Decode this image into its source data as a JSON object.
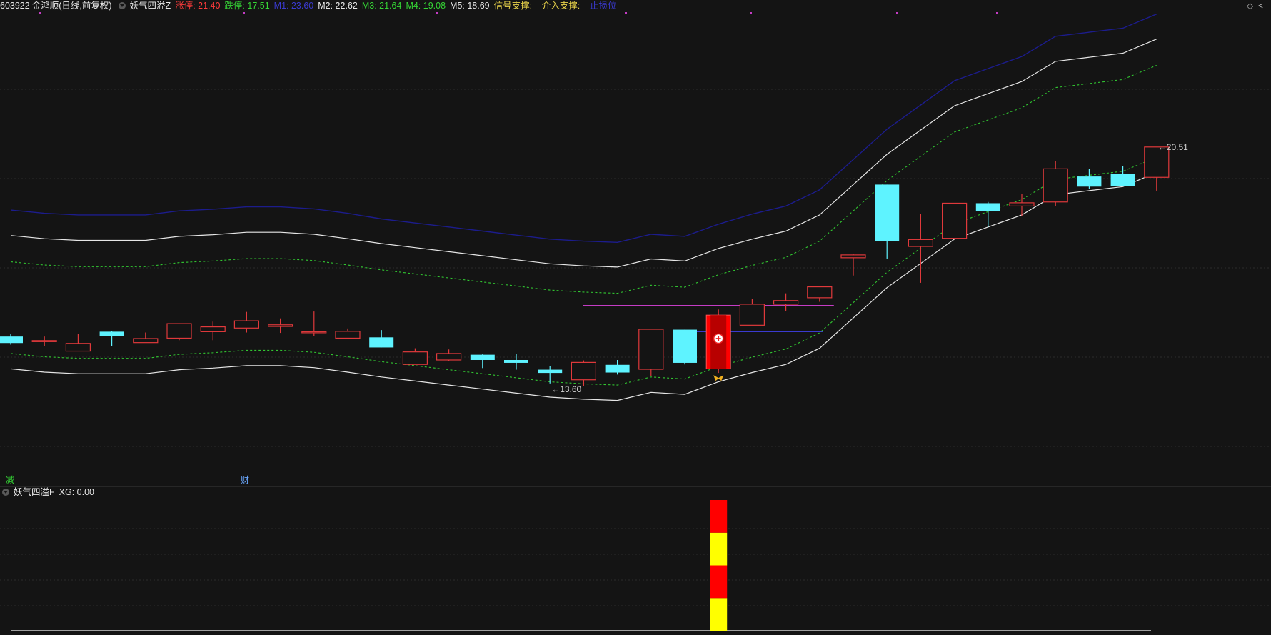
{
  "header": {
    "code": "603922",
    "name": "金鸿顺",
    "period": "(日线,前复权)",
    "indicator": "妖气四溢Z",
    "items": [
      {
        "label": "涨停: 21.40",
        "color": "#ff3b3b"
      },
      {
        "label": "跌停: 17.51",
        "color": "#35d435"
      },
      {
        "label": "M1: 23.60",
        "color": "#3a3ad0"
      },
      {
        "label": "M2: 22.62",
        "color": "#e8e8e8"
      },
      {
        "label": "M3: 21.64",
        "color": "#35d435"
      },
      {
        "label": "M4: 19.08",
        "color": "#35d435"
      },
      {
        "label": "M5: 18.69",
        "color": "#e8e8e8"
      },
      {
        "label": "信号支撑: -",
        "color": "#e8d24a"
      },
      {
        "label": "介入支撑: -",
        "color": "#e8d24a"
      },
      {
        "label": "止损位",
        "color": "#3a3ad0"
      }
    ],
    "corner_icons": [
      "diamond-icon",
      "chevron-left-icon"
    ]
  },
  "lower_header": {
    "indicator": "妖气四溢F",
    "value": "XG: 0.00"
  },
  "markers": {
    "low_label": "←13.60",
    "high_label": "←20.51",
    "event_reduce": "减",
    "event_finance": "财"
  },
  "colors": {
    "background": "#141414",
    "up": "#e0393b",
    "down": "#5ef3ff",
    "m1": "#1c1c8c",
    "band": "#e6e6e6",
    "dashed": "#31c631",
    "grid": "#2b2b2b",
    "signal_red": "#ff0000",
    "signal_yellow": "#ffff00",
    "magenta": "#c43cc4"
  },
  "chart_data": [
    {
      "type": "candlestick",
      "title": "",
      "ylim": [
        12.5,
        24.2
      ],
      "candles": [
        {
          "o": 16.12,
          "c": 15.96,
          "h": 16.18,
          "l": 15.92
        },
        {
          "o": 16.0,
          "c": 16.02,
          "h": 16.12,
          "l": 15.88
        },
        {
          "o": 15.76,
          "c": 15.95,
          "h": 16.19,
          "l": 15.76
        },
        {
          "o": 16.24,
          "c": 16.14,
          "h": 16.25,
          "l": 15.88
        },
        {
          "o": 15.97,
          "c": 16.07,
          "h": 16.22,
          "l": 15.97
        },
        {
          "o": 16.08,
          "c": 16.44,
          "h": 16.45,
          "l": 16.03
        },
        {
          "o": 16.24,
          "c": 16.36,
          "h": 16.49,
          "l": 16.03
        },
        {
          "o": 16.33,
          "c": 16.51,
          "h": 16.73,
          "l": 16.22
        },
        {
          "o": 16.37,
          "c": 16.41,
          "h": 16.57,
          "l": 16.21
        },
        {
          "o": 16.23,
          "c": 16.24,
          "h": 16.74,
          "l": 16.14
        },
        {
          "o": 16.08,
          "c": 16.25,
          "h": 16.32,
          "l": 16.08
        },
        {
          "o": 16.1,
          "c": 15.85,
          "h": 16.28,
          "l": 15.85
        },
        {
          "o": 15.43,
          "c": 15.74,
          "h": 15.83,
          "l": 15.43
        },
        {
          "o": 15.54,
          "c": 15.7,
          "h": 15.8,
          "l": 15.51
        },
        {
          "o": 15.67,
          "c": 15.54,
          "h": 15.68,
          "l": 15.34
        },
        {
          "o": 15.54,
          "c": 15.47,
          "h": 15.69,
          "l": 15.3
        },
        {
          "o": 15.3,
          "c": 15.22,
          "h": 15.39,
          "l": 14.96
        },
        {
          "o": 15.05,
          "c": 15.48,
          "h": 15.53,
          "l": 14.89
        },
        {
          "o": 15.42,
          "c": 15.23,
          "h": 15.54,
          "l": 15.18
        },
        {
          "o": 15.31,
          "c": 16.3,
          "h": 16.3,
          "l": 15.15
        },
        {
          "o": 16.29,
          "c": 15.47,
          "h": 16.29,
          "l": 15.43
        },
        {
          "o": 15.32,
          "c": 16.65,
          "h": 16.79,
          "l": 15.22
        },
        {
          "o": 16.4,
          "c": 16.92,
          "h": 17.06,
          "l": 16.4
        },
        {
          "o": 16.92,
          "c": 17.01,
          "h": 17.19,
          "l": 16.76
        },
        {
          "o": 17.08,
          "c": 17.35,
          "h": 17.35,
          "l": 16.98
        },
        {
          "o": 18.07,
          "c": 18.14,
          "h": 18.16,
          "l": 17.63
        },
        {
          "o": 19.88,
          "c": 18.48,
          "h": 19.88,
          "l": 18.05
        },
        {
          "o": 18.35,
          "c": 18.52,
          "h": 19.15,
          "l": 17.45
        },
        {
          "o": 18.55,
          "c": 19.42,
          "h": 19.42,
          "l": 18.55
        },
        {
          "o": 19.42,
          "c": 19.23,
          "h": 19.45,
          "l": 18.83
        },
        {
          "o": 19.35,
          "c": 19.43,
          "h": 19.65,
          "l": 19.1
        },
        {
          "o": 19.45,
          "c": 20.27,
          "h": 20.46,
          "l": 19.34
        },
        {
          "o": 20.08,
          "c": 19.83,
          "h": 20.27,
          "l": 19.77
        },
        {
          "o": 20.15,
          "c": 19.84,
          "h": 20.33,
          "l": 19.84
        },
        {
          "o": 20.06,
          "c": 20.81,
          "h": 20.81,
          "l": 19.73
        }
      ],
      "signal_candle_index": 21,
      "series": [
        {
          "name": "M1",
          "values": [
            19.25,
            19.17,
            19.13,
            19.13,
            19.13,
            19.23,
            19.27,
            19.33,
            19.33,
            19.28,
            19.17,
            19.03,
            18.93,
            18.83,
            18.73,
            18.63,
            18.53,
            18.48,
            18.45,
            18.65,
            18.6,
            18.9,
            19.15,
            19.35,
            19.75,
            20.5,
            21.25,
            21.85,
            22.45,
            22.75,
            23.05,
            23.55,
            23.65,
            23.75,
            24.1
          ]
        },
        {
          "name": "M2",
          "values": [
            18.62,
            18.54,
            18.5,
            18.5,
            18.5,
            18.6,
            18.64,
            18.7,
            18.7,
            18.65,
            18.54,
            18.42,
            18.32,
            18.22,
            18.12,
            18.02,
            17.92,
            17.87,
            17.84,
            18.04,
            17.99,
            18.3,
            18.53,
            18.73,
            19.13,
            19.88,
            20.63,
            21.23,
            21.83,
            22.13,
            22.43,
            22.93,
            23.03,
            23.13,
            23.48
          ]
        },
        {
          "name": "M3",
          "values": [
            17.97,
            17.89,
            17.85,
            17.85,
            17.85,
            17.95,
            17.99,
            18.05,
            18.05,
            18.0,
            17.89,
            17.77,
            17.67,
            17.57,
            17.47,
            17.37,
            17.27,
            17.22,
            17.19,
            17.39,
            17.34,
            17.65,
            17.88,
            18.08,
            18.48,
            19.23,
            19.98,
            20.58,
            21.18,
            21.48,
            21.78,
            22.28,
            22.38,
            22.48,
            22.83
          ]
        },
        {
          "name": "M4",
          "values": [
            15.7,
            15.62,
            15.58,
            15.58,
            15.58,
            15.68,
            15.72,
            15.78,
            15.78,
            15.73,
            15.62,
            15.5,
            15.4,
            15.3,
            15.2,
            15.1,
            15.0,
            14.95,
            14.92,
            15.12,
            15.07,
            15.38,
            15.61,
            15.81,
            16.21,
            16.96,
            17.71,
            18.31,
            18.91,
            19.21,
            19.51,
            20.01,
            20.11,
            20.21,
            20.56
          ]
        },
        {
          "name": "M5",
          "values": [
            15.32,
            15.24,
            15.2,
            15.2,
            15.2,
            15.3,
            15.34,
            15.4,
            15.4,
            15.35,
            15.24,
            15.12,
            15.02,
            14.92,
            14.82,
            14.72,
            14.62,
            14.57,
            14.54,
            14.74,
            14.69,
            15.0,
            15.23,
            15.43,
            15.83,
            16.58,
            17.33,
            17.93,
            18.53,
            18.83,
            19.13,
            19.63,
            19.73,
            19.83,
            20.18
          ]
        }
      ],
      "levels": [
        {
          "name": "",
          "value": 16.89,
          "color": "#c43cc4"
        },
        {
          "name": "",
          "value": 16.24,
          "color": "#3a3ad0"
        }
      ]
    },
    {
      "type": "bar",
      "title": "",
      "ylim": [
        0,
        1
      ],
      "xg_index": 21,
      "segments": [
        "#ffff00",
        "#ff0000",
        "#ffff00",
        "#ff0000"
      ]
    }
  ]
}
